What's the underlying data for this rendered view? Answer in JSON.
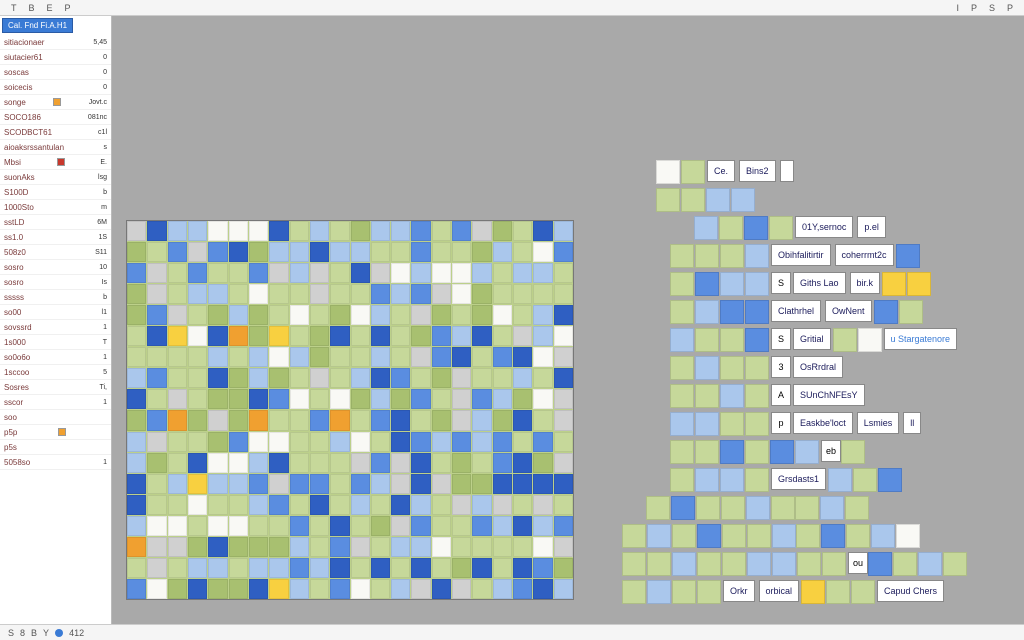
{
  "toolbar": {
    "items": [
      "T",
      "B",
      "E",
      "P",
      "I",
      "P",
      "S",
      "P",
      "·",
      "·",
      "·"
    ]
  },
  "sidebar": {
    "tab": "Cal. Fnd Fi.A.H1",
    "rows": [
      {
        "k": "sitiacionaer",
        "v": "5,45"
      },
      {
        "k": "siutacier61",
        "v": "0"
      },
      {
        "k": "soscas",
        "v": "0"
      },
      {
        "k": "soicecis",
        "v": "0"
      },
      {
        "k": "songe",
        "v": "Jovt.c",
        "sq": "#f0a030"
      },
      {
        "k": "SOCO186",
        "v": "081nc"
      },
      {
        "k": "SCODBCT61",
        "v": "c1l"
      },
      {
        "k": "aioaksrssantulan",
        "v": "s"
      },
      {
        "k": "Mbsi",
        "v": "E.",
        "sq": "#c8382c"
      },
      {
        "k": "suonAks",
        "v": "lsg"
      },
      {
        "k": "S100D",
        "v": "b"
      },
      {
        "k": "1000Sto",
        "v": "m"
      },
      {
        "k": "sstLD",
        "v": "6M"
      },
      {
        "k": "ss1.0",
        "v": "1S"
      },
      {
        "k": "508z0",
        "v": "S11"
      },
      {
        "k": "sosro",
        "v": "10"
      },
      {
        "k": "sosro",
        "v": "Is"
      },
      {
        "k": "sssss",
        "v": "b"
      },
      {
        "k": "so00",
        "v": "l1"
      },
      {
        "k": "sovssrd",
        "v": "1"
      },
      {
        "k": "1s000",
        "v": "T"
      },
      {
        "k": "so0o6o",
        "v": "1"
      },
      {
        "k": "1sccoo",
        "v": "5"
      },
      {
        "k": "Sosres",
        "v": "Ti,"
      },
      {
        "k": "sscor",
        "v": "1"
      },
      {
        "k": "soo",
        "v": ""
      },
      {
        "k": "p5p",
        "v": "",
        "sq": "#f0a030"
      },
      {
        "k": "p5s",
        "v": ""
      },
      {
        "k": "5058so",
        "v": "1"
      }
    ]
  },
  "panel2": {
    "rows": [
      {
        "offset": 58,
        "pre": [
          "w",
          "g"
        ],
        "labels": [
          {
            "t": "Ce."
          },
          {
            "t": "Bins2"
          },
          {
            "t": ""
          }
        ],
        "post": []
      },
      {
        "offset": 58,
        "pre": [
          "g",
          "g",
          "lb",
          "lb"
        ],
        "labels": [],
        "post": []
      },
      {
        "offset": 96,
        "pre": [
          "lb",
          "g",
          "b",
          "g"
        ],
        "labels": [
          {
            "t": "01Y,sernoc"
          },
          {
            "t": "p.el"
          }
        ],
        "post": []
      },
      {
        "offset": 72,
        "pre": [
          "g",
          "g",
          "g",
          "lb"
        ],
        "labels": [
          {
            "t": "Obihfalitirtir"
          },
          {
            "t": "coherrmt2c"
          }
        ],
        "post": [
          "b"
        ]
      },
      {
        "offset": 72,
        "pre": [
          "g",
          "b",
          "lb",
          "lb"
        ],
        "mini": "S",
        "labels": [
          {
            "t": "Giths Lao"
          },
          {
            "t": "bir.k"
          }
        ],
        "post": [
          "y",
          "y"
        ]
      },
      {
        "offset": 72,
        "pre": [
          "g",
          "lb",
          "b",
          "b"
        ],
        "labels": [
          {
            "t": "Clathrhel"
          },
          {
            "t": "OwNent"
          }
        ],
        "post": [
          "b",
          "g"
        ]
      },
      {
        "offset": 72,
        "pre": [
          "lb",
          "g",
          "g",
          "b"
        ],
        "mini": "S",
        "labels": [
          {
            "t": "Gritial"
          }
        ],
        "post": [
          "g",
          "w"
        ],
        "tail": {
          "t": "u Stargatenore",
          "c": "#3a7bd5"
        }
      },
      {
        "offset": 72,
        "pre": [
          "g",
          "lb",
          "g",
          "g"
        ],
        "mini": "3",
        "labels": [
          {
            "t": "OsRrdral"
          }
        ],
        "post": []
      },
      {
        "offset": 72,
        "pre": [
          "g",
          "g",
          "lb",
          "g"
        ],
        "mini": "A",
        "labels": [
          {
            "t": "SUnChNFEsY"
          }
        ],
        "post": []
      },
      {
        "offset": 72,
        "pre": [
          "lb",
          "lb",
          "g",
          "g"
        ],
        "mini": "p",
        "labels": [
          {
            "t": "Easkbe'loct"
          },
          {
            "t": "Lsmies"
          },
          {
            "t": "ll"
          }
        ],
        "post": []
      },
      {
        "offset": 72,
        "pre": [
          "g",
          "g",
          "b",
          "g",
          "b",
          "lb"
        ],
        "mini": "eb",
        "labels": [],
        "post": [
          "g"
        ]
      },
      {
        "offset": 72,
        "pre": [
          "g",
          "lb",
          "lb",
          "g"
        ],
        "labels": [
          {
            "t": "Grsdasts1"
          }
        ],
        "post": [
          "lb",
          "g",
          "b"
        ]
      },
      {
        "offset": 48,
        "pre": [
          "g",
          "b",
          "g",
          "g",
          "lb",
          "g"
        ],
        "labels": [],
        "post": [
          "g",
          "lb",
          "g"
        ]
      },
      {
        "offset": 24,
        "pre": [
          "g",
          "lb",
          "g",
          "b",
          "g",
          "g",
          "lb"
        ],
        "labels": [],
        "post": [
          "g",
          "b",
          "g",
          "lb",
          "w"
        ]
      },
      {
        "offset": 24,
        "pre": [
          "g",
          "g",
          "lb",
          "g",
          "g",
          "lb",
          "lb",
          "g",
          "g"
        ],
        "mini": "ou",
        "labels": [],
        "post": [
          "b",
          "g",
          "lb",
          "g"
        ]
      },
      {
        "offset": 24,
        "pre": [
          "g",
          "lb",
          "g",
          "g"
        ],
        "labels": [
          {
            "t": "Orkr"
          },
          {
            "t": "orbical"
          }
        ],
        "post": [
          "y",
          "g",
          "g"
        ],
        "tail": {
          "t": "Capud  Chers"
        }
      }
    ]
  },
  "statusbar": {
    "items": [
      "S",
      "8",
      "B",
      "Y",
      "",
      "412"
    ]
  },
  "colors": {
    "green": "#c6d89a",
    "dgreen": "#a8c070",
    "blue": "#5a8de0",
    "lblue": "#aac7ec",
    "dblue": "#2f5fc2",
    "white": "#f9f9f5",
    "orange": "#f0a030",
    "yellow": "#f8d040",
    "grey": "#d0d0d0"
  }
}
